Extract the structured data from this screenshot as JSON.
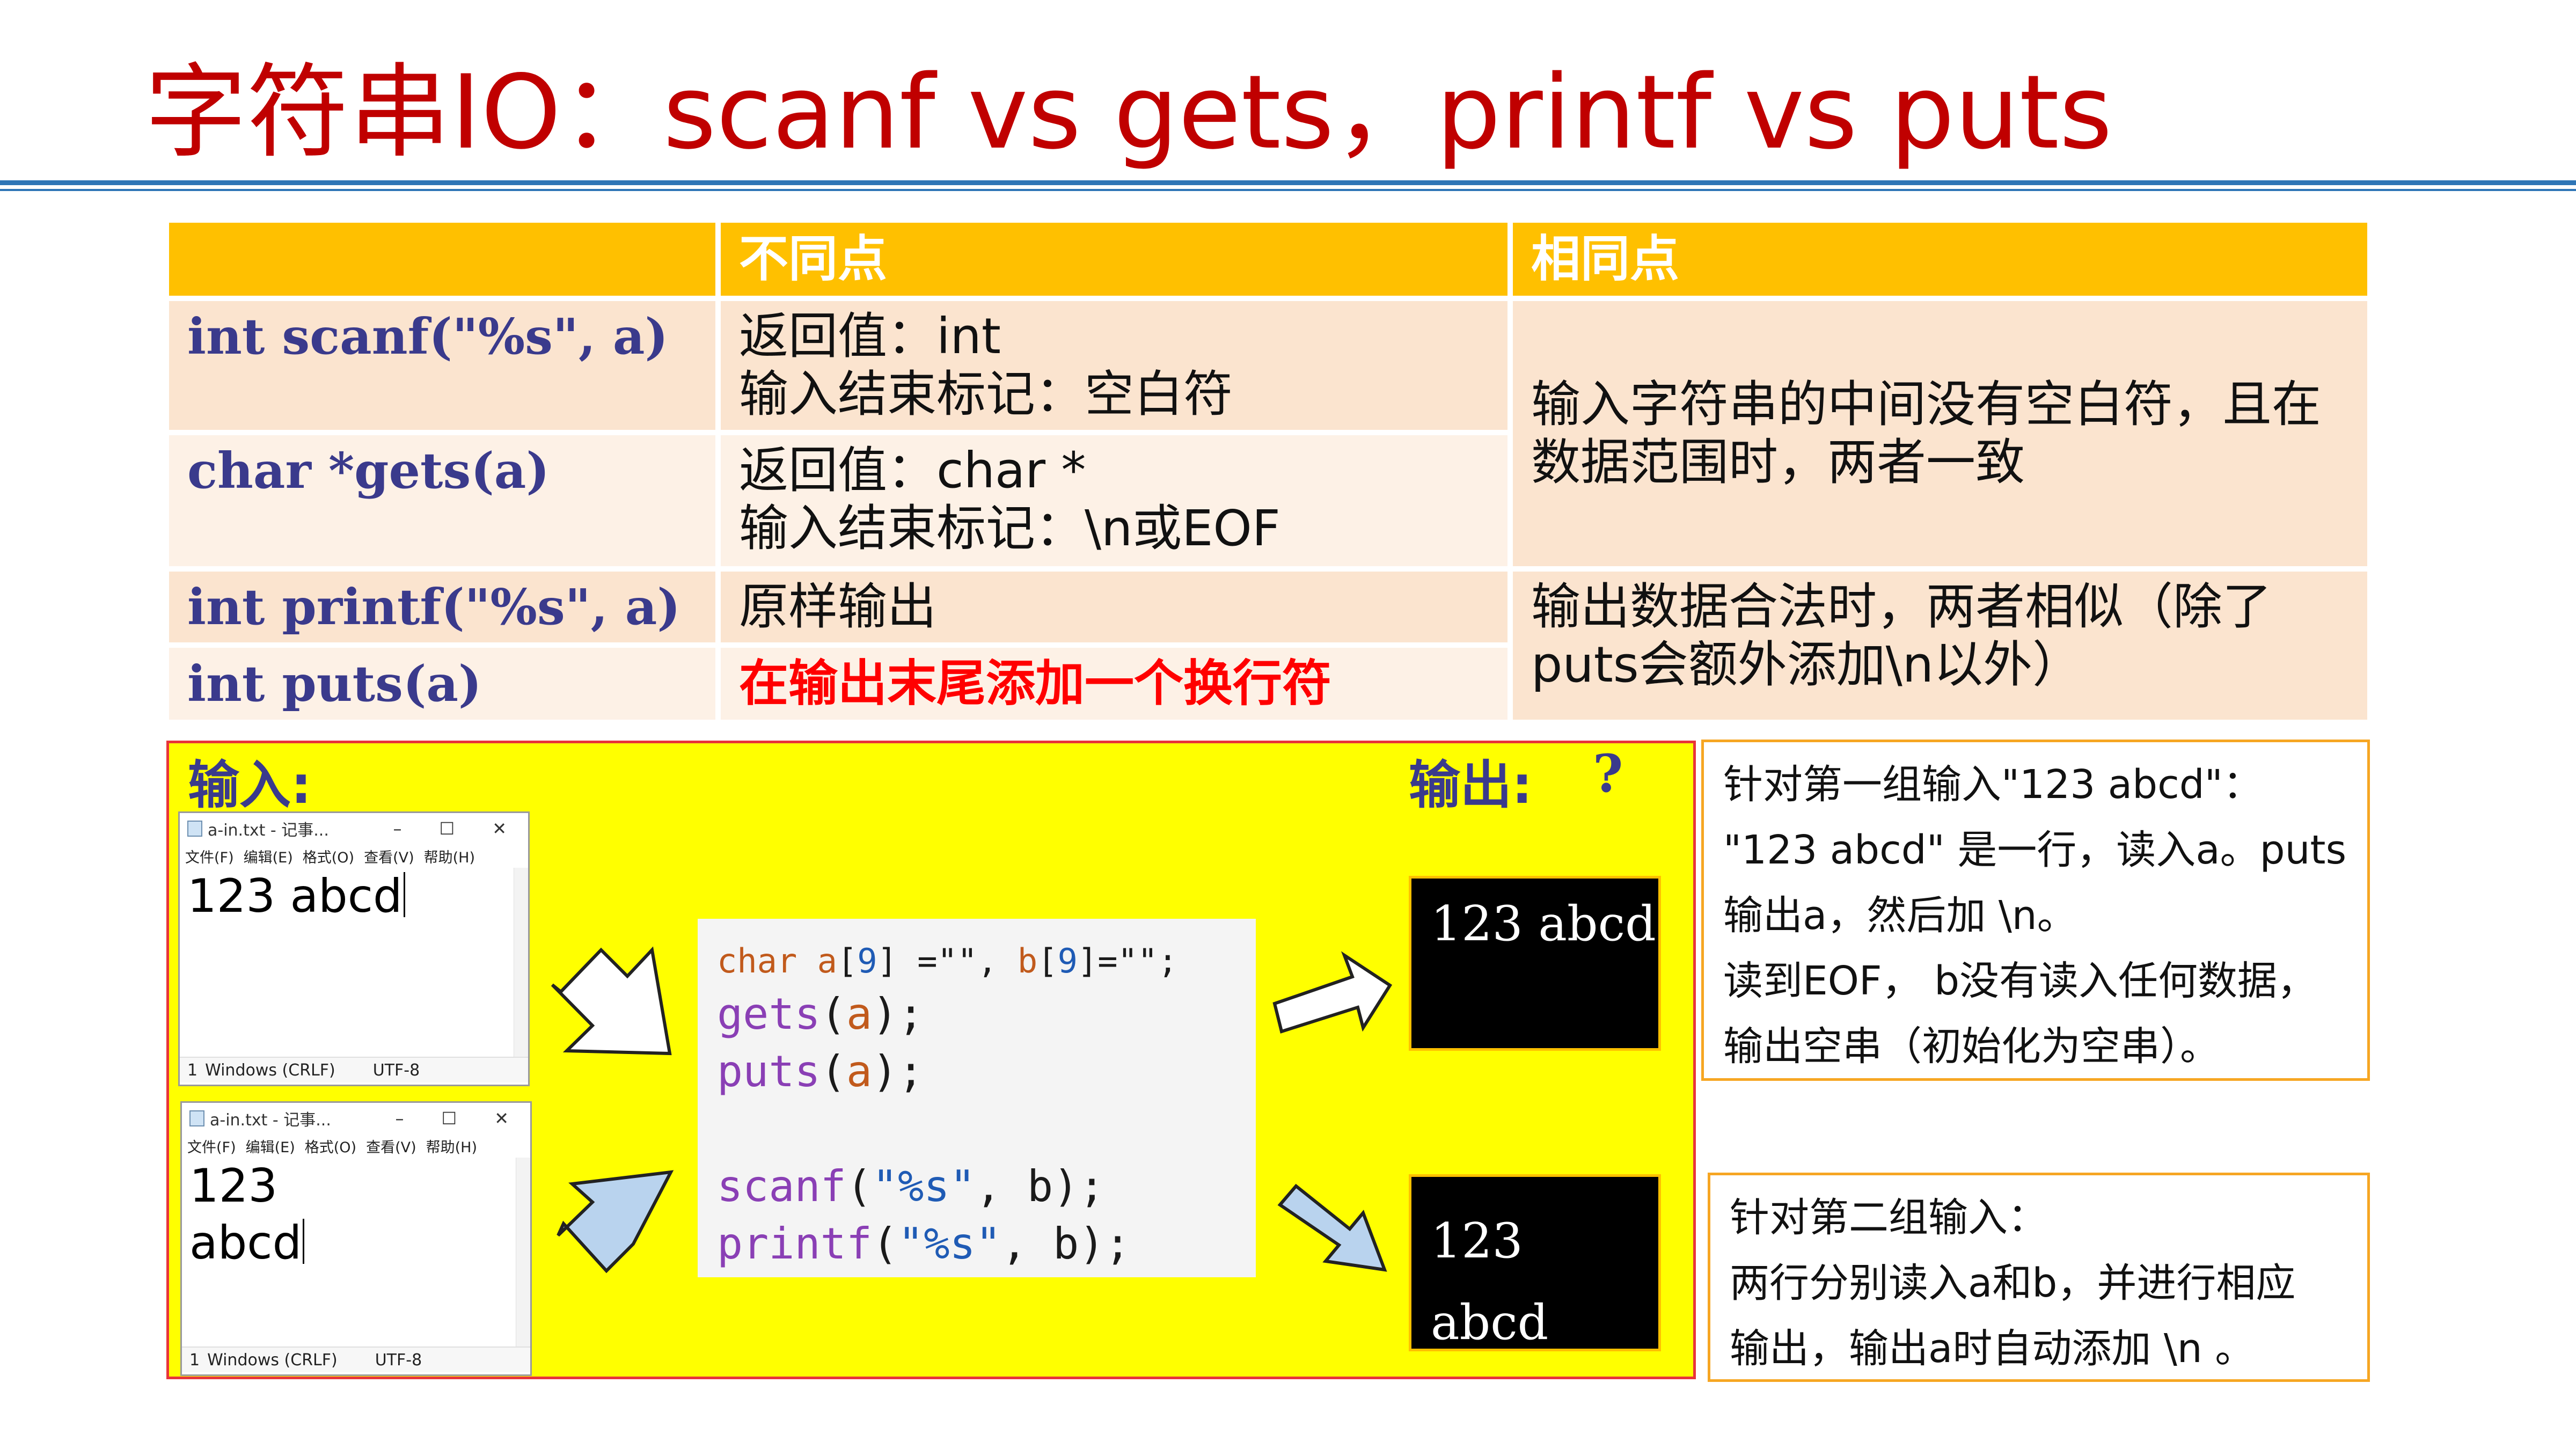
{
  "title": "字符串IO：scanf  vs  gets，printf  vs  puts",
  "table": {
    "headers": [
      "",
      "不同点",
      "相同点"
    ],
    "rows": [
      {
        "fn": "int scanf(\"%s\", a)",
        "diff_1": "返回值：int",
        "diff_2": "输入结束标记：空白符"
      },
      {
        "fn": "char *gets(a)",
        "diff_1": "返回值：char *",
        "diff_2": "输入结束标记：\\n或EOF"
      },
      {
        "fn": "int printf(\"%s\", a)",
        "diff_1": "原样输出"
      },
      {
        "fn": "int puts(a)",
        "diff_1": "在输出末尾添加一个换行符"
      }
    ],
    "same_input": "输入字符串的中间没有空白符，且在数据范围时，两者一致",
    "same_output": "输出数据合法时，两者相似（除了puts会额外添加\\n以外）"
  },
  "panel": {
    "input_label": "输入:",
    "output_label": "输出:",
    "output_mark": "?"
  },
  "notepads": [
    {
      "title": "a-in.txt - 记事...",
      "menu": [
        "文件(F)",
        "编辑(E)",
        "格式(O)",
        "查看(V)",
        "帮助(H)"
      ],
      "lines": [
        "123 abcd"
      ],
      "status": [
        "1",
        "Windows (CRLF)",
        "UTF-8"
      ]
    },
    {
      "title": "a-in.txt - 记事...",
      "menu": [
        "文件(F)",
        "编辑(E)",
        "格式(O)",
        "查看(V)",
        "帮助(H)"
      ],
      "lines": [
        "123",
        "abcd"
      ],
      "status": [
        "1",
        "Windows (CRLF)",
        "UTF-8"
      ]
    }
  ],
  "window_controls": [
    "–",
    "☐",
    "✕"
  ],
  "code": {
    "decl": {
      "type": "char",
      "a": "a",
      "b": "b",
      "size": "9",
      "init": "\"\""
    },
    "gets": "gets",
    "puts": "puts",
    "scanf": "scanf",
    "printf": "printf",
    "fmt": "\"%s\""
  },
  "outputs": [
    {
      "lines": [
        "123 abcd"
      ]
    },
    {
      "lines": [
        "123",
        "abcd"
      ]
    }
  ],
  "notes": [
    {
      "lines": [
        "针对第一组输入\"123 abcd\"：",
        "\"123 abcd\" 是一行，读入a。puts",
        "输出a，然后加 \\n。",
        "读到EOF， b没有读入任何数据，",
        "输出空串（初始化为空串）。"
      ]
    },
    {
      "lines": [
        "针对第二组输入：",
        "两行分别读入a和b，并进行相应",
        "输出，输出a时自动添加 \\n 。"
      ]
    }
  ],
  "colors": {
    "title": "#c00000",
    "header": "#ffc000",
    "panel": "#ffff00",
    "arrow_fill": "#b9d3ee",
    "note_border": "#f6a623"
  }
}
